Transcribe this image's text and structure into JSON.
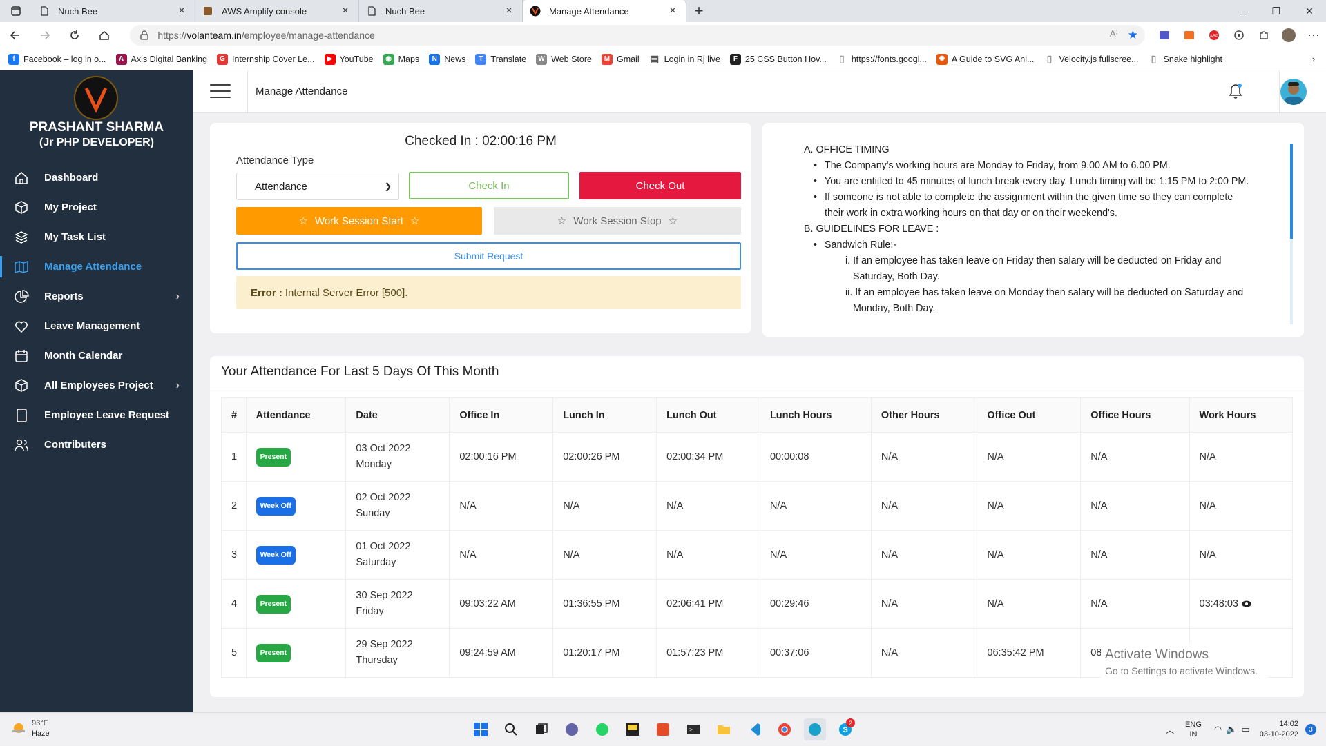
{
  "browser": {
    "tabs": [
      {
        "title": "Nuch Bee",
        "icon": "page-icon"
      },
      {
        "title": "AWS Amplify console",
        "icon": "aws-icon"
      },
      {
        "title": "Nuch Bee",
        "icon": "page-icon"
      },
      {
        "title": "Manage Attendance",
        "icon": "v-logo-icon",
        "active": true
      }
    ],
    "url_prefix": "https://",
    "url_domain": "volanteam.in",
    "url_path": "/employee/manage-attendance",
    "bookmarks": [
      {
        "label": "Facebook – log in o...",
        "color": "#1877f2",
        "glyph": "f"
      },
      {
        "label": "Axis Digital Banking",
        "color": "#97144d",
        "glyph": "A"
      },
      {
        "label": "Internship Cover Le...",
        "color": "#e53935",
        "glyph": "G"
      },
      {
        "label": "YouTube",
        "color": "#ff0000",
        "glyph": "▶"
      },
      {
        "label": "Maps",
        "color": "#34a853",
        "glyph": "◉"
      },
      {
        "label": "News",
        "color": "#1a73e8",
        "glyph": "N"
      },
      {
        "label": "Translate",
        "color": "#4285f4",
        "glyph": "T"
      },
      {
        "label": "Web Store",
        "color": "#888888",
        "glyph": "W"
      },
      {
        "label": "Gmail",
        "color": "#ea4335",
        "glyph": "M"
      },
      {
        "label": "Login in Rj live",
        "color": "#555555",
        "glyph": "▤"
      },
      {
        "label": "25 CSS Button Hov...",
        "color": "#222222",
        "glyph": "F"
      },
      {
        "label": "https://fonts.googl...",
        "color": "#999999",
        "glyph": "▯"
      },
      {
        "label": "A Guide to SVG Ani...",
        "color": "#e8580c",
        "glyph": "✺"
      },
      {
        "label": "Velocity.js fullscree...",
        "color": "#999999",
        "glyph": "▯"
      },
      {
        "label": "Snake highlight",
        "color": "#999999",
        "glyph": "▯"
      }
    ]
  },
  "sidebar": {
    "name": "PRASHANT SHARMA",
    "role": "(Jr PHP DEVELOPER)",
    "items": [
      {
        "label": "Dashboard",
        "icon": "home-icon"
      },
      {
        "label": "My Project",
        "icon": "cube-icon"
      },
      {
        "label": "My Task List",
        "icon": "layers-icon"
      },
      {
        "label": "Manage Attendance",
        "icon": "map-icon",
        "active": true
      },
      {
        "label": "Reports",
        "icon": "pie-chart-icon",
        "has_children": true
      },
      {
        "label": "Leave Management",
        "icon": "heart-icon"
      },
      {
        "label": "Month Calendar",
        "icon": "calendar-icon"
      },
      {
        "label": "All Employees Project",
        "icon": "cube-icon",
        "has_children": true
      },
      {
        "label": "Employee Leave Request",
        "icon": "tablet-icon"
      },
      {
        "label": "Contributers",
        "icon": "users-icon"
      }
    ]
  },
  "header": {
    "title": "Manage Attendance"
  },
  "attendance_form": {
    "checked_in": "Checked In : 02:00:16 PM",
    "type_label": "Attendance Type",
    "type_value": "Attendance",
    "check_in": "Check In",
    "check_out": "Check Out",
    "ws_start": "Work Session Start",
    "ws_stop": "Work Session Stop",
    "submit": "Submit Request",
    "error_label": "Error :",
    "error_text": "Internal Server Error [500]."
  },
  "rules": {
    "a_title": "A. OFFICE TIMING",
    "a1": "The Company's working hours are Monday to Friday, from 9.00 AM to 6.00 PM.",
    "a2": "You are entitled to 45 minutes of lunch break every day. Lunch timing will be 1:15 PM to 2:00 PM.",
    "a3a": "If someone is not able to complete the assignment within the given time so they can complete",
    "a3b": "their work in extra working hours on that day or on their weekend's.",
    "b_title": "B. GUIDELINES FOR LEAVE :",
    "b1": "Sandwich Rule:-",
    "b1i_a": "i. If an employee has taken leave on Friday then salary will be deducted on Friday and",
    "b1i_b": "Saturday, Both Day.",
    "b1ii_a": "ii. If an employee has taken leave on Monday then salary will be deducted on Saturday and",
    "b1ii_b": "Monday, Both Day."
  },
  "table": {
    "title": "Your Attendance For Last 5 Days Of This Month",
    "columns": [
      "#",
      "Attendance",
      "Date",
      "Office In",
      "Lunch In",
      "Lunch Out",
      "Lunch Hours",
      "Other Hours",
      "Office Out",
      "Office Hours",
      "Work Hours"
    ],
    "rows": [
      {
        "n": "1",
        "status": "Present",
        "date": "03 Oct 2022",
        "day": "Monday",
        "office_in": "02:00:16 PM",
        "lunch_in": "02:00:26 PM",
        "lunch_out": "02:00:34 PM",
        "lunch_hours": "00:00:08",
        "other_hours": "N/A",
        "office_out": "N/A",
        "office_hours": "N/A",
        "work_hours": "N/A"
      },
      {
        "n": "2",
        "status": "Week Off",
        "date": "02 Oct 2022",
        "day": "Sunday",
        "office_in": "N/A",
        "lunch_in": "N/A",
        "lunch_out": "N/A",
        "lunch_hours": "N/A",
        "other_hours": "N/A",
        "office_out": "N/A",
        "office_hours": "N/A",
        "work_hours": "N/A"
      },
      {
        "n": "3",
        "status": "Week Off",
        "date": "01 Oct 2022",
        "day": "Saturday",
        "office_in": "N/A",
        "lunch_in": "N/A",
        "lunch_out": "N/A",
        "lunch_hours": "N/A",
        "other_hours": "N/A",
        "office_out": "N/A",
        "office_hours": "N/A",
        "work_hours": "N/A"
      },
      {
        "n": "4",
        "status": "Present",
        "date": "30 Sep 2022",
        "day": "Friday",
        "office_in": "09:03:22 AM",
        "lunch_in": "01:36:55 PM",
        "lunch_out": "02:06:41 PM",
        "lunch_hours": "00:29:46",
        "other_hours": "N/A",
        "office_out": "N/A",
        "office_hours": "N/A",
        "work_hours": "03:48:03"
      },
      {
        "n": "5",
        "status": "Present",
        "date": "29 Sep 2022",
        "day": "Thursday",
        "office_in": "09:24:59 AM",
        "lunch_in": "01:20:17 PM",
        "lunch_out": "01:57:23 PM",
        "lunch_hours": "00:37:06",
        "other_hours": "N/A",
        "office_out": "06:35:42 PM",
        "office_hours": "08",
        "work_hours": ""
      }
    ]
  },
  "watermark": {
    "line1": "Activate Windows",
    "line2": "Go to Settings to activate Windows."
  },
  "taskbar": {
    "temp": "93°F",
    "weather": "Haze",
    "lang1": "ENG",
    "lang2": "IN",
    "time": "14:02",
    "date": "03-10-2022",
    "notifications": "3",
    "skype_badge": "2"
  },
  "colors": {
    "accent": "#3aa0f0",
    "sidebar": "#222f3e",
    "checkout": "#e5193f",
    "ws_start": "#ff9a00",
    "present": "#28a745",
    "weekoff": "#1a6fe6"
  }
}
